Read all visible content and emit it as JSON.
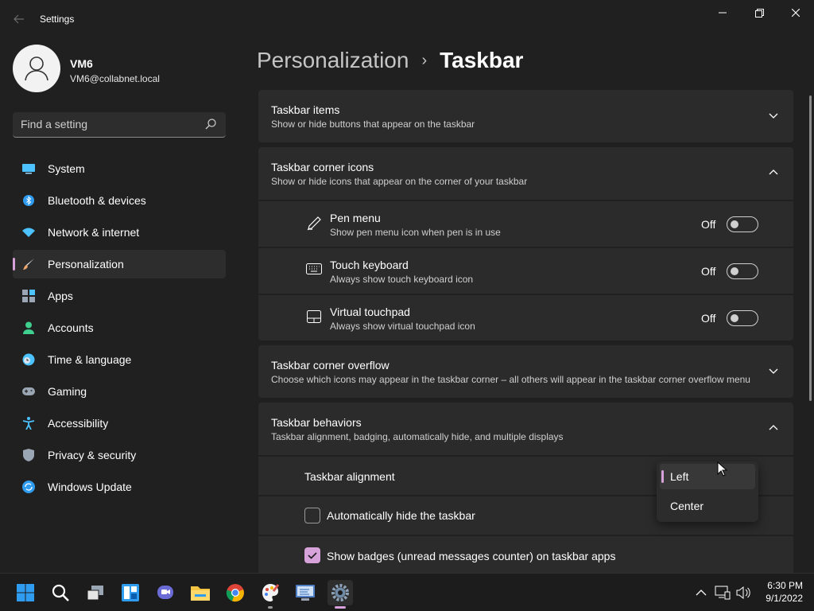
{
  "window": {
    "title": "Settings"
  },
  "profile": {
    "name": "VM6",
    "email": "VM6@collabnet.local"
  },
  "search": {
    "placeholder": "Find a setting"
  },
  "sidebar": {
    "items": [
      {
        "label": "System",
        "icon": "system-icon",
        "color": "#4cc2ff"
      },
      {
        "label": "Bluetooth & devices",
        "icon": "bluetooth-icon",
        "color": "#4cc2ff"
      },
      {
        "label": "Network & internet",
        "icon": "wifi-icon",
        "color": "#4cc2ff"
      },
      {
        "label": "Personalization",
        "icon": "brush-icon",
        "color": "#f2a96b",
        "active": true
      },
      {
        "label": "Apps",
        "icon": "apps-icon",
        "color": "#9aa6b3"
      },
      {
        "label": "Accounts",
        "icon": "person-icon",
        "color": "#3fcf8e"
      },
      {
        "label": "Time & language",
        "icon": "clock-globe-icon",
        "color": "#4cc2ff"
      },
      {
        "label": "Gaming",
        "icon": "gamepad-icon",
        "color": "#9aa6b3"
      },
      {
        "label": "Accessibility",
        "icon": "accessibility-icon",
        "color": "#4cc2ff"
      },
      {
        "label": "Privacy & security",
        "icon": "shield-icon",
        "color": "#9aa6b3"
      },
      {
        "label": "Windows Update",
        "icon": "update-icon",
        "color": "#2f9cf0"
      }
    ]
  },
  "breadcrumb": {
    "parent": "Personalization",
    "separator": "›",
    "current": "Taskbar"
  },
  "sections": {
    "taskbar_items": {
      "title": "Taskbar items",
      "subtitle": "Show or hide buttons that appear on the taskbar",
      "expanded": false
    },
    "corner_icons": {
      "title": "Taskbar corner icons",
      "subtitle": "Show or hide icons that appear on the corner of your taskbar",
      "expanded": true,
      "rows": [
        {
          "title": "Pen menu",
          "subtitle": "Show pen menu icon when pen is in use",
          "state": "Off",
          "icon": "pen-icon"
        },
        {
          "title": "Touch keyboard",
          "subtitle": "Always show touch keyboard icon",
          "state": "Off",
          "icon": "keyboard-icon"
        },
        {
          "title": "Virtual touchpad",
          "subtitle": "Always show virtual touchpad icon",
          "state": "Off",
          "icon": "touchpad-icon"
        }
      ]
    },
    "corner_overflow": {
      "title": "Taskbar corner overflow",
      "subtitle": "Choose which icons may appear in the taskbar corner – all others will appear in the taskbar corner overflow menu",
      "expanded": false
    },
    "behaviors": {
      "title": "Taskbar behaviors",
      "subtitle": "Taskbar alignment, badging, automatically hide, and multiple displays",
      "expanded": true,
      "alignment_label": "Taskbar alignment",
      "alignment_options": [
        "Left",
        "Center"
      ],
      "alignment_selected": "Left",
      "auto_hide": {
        "label": "Automatically hide the taskbar",
        "checked": false
      },
      "badges": {
        "label": "Show badges (unread messages counter) on taskbar apps",
        "checked": true
      }
    }
  },
  "taskbar": {
    "apps": [
      "start-icon",
      "search-icon",
      "task-view-icon",
      "widgets-icon",
      "teams-chat-icon",
      "file-explorer-icon",
      "chrome-icon",
      "paint-icon",
      "remote-desktop-icon",
      "settings-icon"
    ],
    "clock_time": "6:30 PM",
    "clock_date": "9/1/2022"
  },
  "colors": {
    "accent": "#d7a1d9",
    "background": "#202020",
    "card": "#2b2b2b"
  }
}
